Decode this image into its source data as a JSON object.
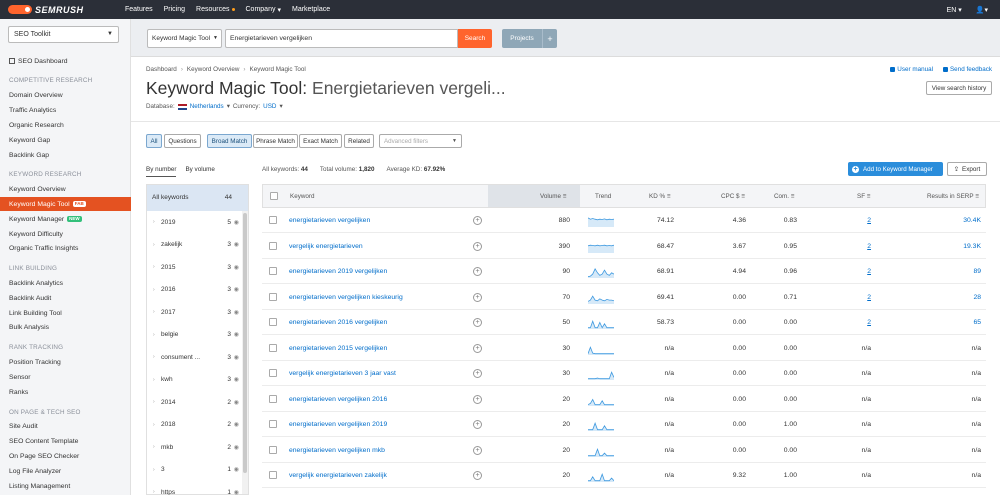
{
  "topbar": {
    "brand": "SEMRUSH",
    "nav": [
      "Features",
      "Pricing",
      "Resources",
      "Company",
      "Marketplace"
    ],
    "lang": "EN",
    "colors": {
      "bg": "#2b2f38",
      "accent": "#ff642d"
    }
  },
  "sidebar": {
    "toolkit": "SEO Toolkit",
    "dashboard": "SEO Dashboard",
    "sections": {
      "competitive": "COMPETITIVE RESEARCH",
      "keyword": "KEYWORD RESEARCH",
      "link": "LINK BUILDING",
      "rank": "RANK TRACKING",
      "onpage": "ON PAGE & TECH SEO"
    },
    "items": {
      "domain_overview": "Domain Overview",
      "traffic_analytics": "Traffic Analytics",
      "organic_research": "Organic Research",
      "keyword_gap": "Keyword Gap",
      "backlink_gap": "Backlink Gap",
      "keyword_overview": "Keyword Overview",
      "keyword_magic": "Keyword Magic Tool",
      "keyword_manager": "Keyword Manager",
      "keyword_difficulty": "Keyword Difficulty",
      "organic_insights": "Organic Traffic Insights",
      "backlink_analytics": "Backlink Analytics",
      "backlink_audit": "Backlink Audit",
      "link_building_tool": "Link Building Tool",
      "bulk_analysis": "Bulk Analysis",
      "position_tracking": "Position Tracking",
      "sensor": "Sensor",
      "ranks": "Ranks",
      "site_audit": "Site Audit",
      "seo_content_template": "SEO Content Template",
      "on_page_checker": "On Page SEO Checker",
      "log_file_analyzer": "Log File Analyzer",
      "listing_management": "Listing Management"
    },
    "badge_magic": "FAB",
    "badge_manager": "NEW"
  },
  "search": {
    "database": "Keyword Magic Tool",
    "query": "Energietarieven vergelijken",
    "button": "Search",
    "projects": "Projects",
    "projects_plus": "+"
  },
  "header": {
    "breadcrumb": [
      "Dashboard",
      "Keyword Overview",
      "Keyword Magic Tool"
    ],
    "title_prefix": "Keyword Magic Tool:",
    "title_keyword": "Energietarieven vergeli...",
    "database_label": "Database:",
    "database_value": "Netherlands",
    "currency_label": "Currency:",
    "currency_value": "USD",
    "user_manual": "User manual",
    "send_feedback": "Send feedback",
    "view_history": "View search history"
  },
  "filters": {
    "all": "All",
    "questions": "Questions",
    "broad": "Broad Match",
    "phrase": "Phrase Match",
    "exact": "Exact Match",
    "related": "Related",
    "advanced_placeholder": "Advanced filters"
  },
  "groups": {
    "tab_number": "By number",
    "tab_volume": "By volume",
    "all_label": "All keywords",
    "all_count": "44",
    "rows": [
      {
        "name": "2019",
        "count": "5"
      },
      {
        "name": "zakelijk",
        "count": "3"
      },
      {
        "name": "2015",
        "count": "3"
      },
      {
        "name": "2016",
        "count": "3"
      },
      {
        "name": "2017",
        "count": "3"
      },
      {
        "name": "belgie",
        "count": "3"
      },
      {
        "name": "consument ...",
        "count": "3"
      },
      {
        "name": "kwh",
        "count": "3"
      },
      {
        "name": "2014",
        "count": "2"
      },
      {
        "name": "2018",
        "count": "2"
      },
      {
        "name": "mkb",
        "count": "2"
      },
      {
        "name": "3",
        "count": "1"
      },
      {
        "name": "https",
        "count": "1"
      }
    ]
  },
  "stats": {
    "all_label": "All keywords:",
    "all_value": "44",
    "volume_label": "Total volume:",
    "volume_value": "1,820",
    "kd_label": "Average KD:",
    "kd_value": "67.92%",
    "add_button": "Add to Keyword Manager",
    "export_button": "Export"
  },
  "table": {
    "headers": {
      "keyword": "Keyword",
      "volume": "Volume",
      "trend": "Trend",
      "kd": "KD %",
      "cpc": "CPC $",
      "com": "Com.",
      "sf": "SF",
      "results": "Results in SERP"
    },
    "rows": [
      {
        "keyword": "energietarieven vergelijken",
        "volume": "880",
        "kd": "74.12",
        "cpc": "4.36",
        "com": "0.83",
        "sf": "2",
        "results": "30.4K",
        "trend": [
          0.7,
          0.6,
          0.65,
          0.6,
          0.55,
          0.6,
          0.58,
          0.62,
          0.55,
          0.6,
          0.58,
          0.6
        ]
      },
      {
        "keyword": "vergelijk energietarieven",
        "volume": "390",
        "kd": "68.47",
        "cpc": "3.67",
        "com": "0.95",
        "sf": "2",
        "results": "19.3K",
        "trend": [
          0.55,
          0.6,
          0.58,
          0.55,
          0.6,
          0.55,
          0.58,
          0.6,
          0.55,
          0.58,
          0.55,
          0.6
        ]
      },
      {
        "keyword": "energietarieven 2019 vergelijken",
        "volume": "90",
        "kd": "68.91",
        "cpc": "4.94",
        "com": "0.96",
        "sf": "2",
        "results": "89",
        "trend": [
          0.1,
          0.15,
          0.3,
          0.7,
          0.4,
          0.2,
          0.3,
          0.6,
          0.3,
          0.2,
          0.4,
          0.3
        ]
      },
      {
        "keyword": "energietarieven vergelijken kieskeurig",
        "volume": "70",
        "kd": "69.41",
        "cpc": "0.00",
        "com": "0.71",
        "sf": "2",
        "results": "28",
        "trend": [
          0.2,
          0.3,
          0.6,
          0.3,
          0.25,
          0.4,
          0.3,
          0.25,
          0.35,
          0.3,
          0.3,
          0.25
        ]
      },
      {
        "keyword": "energietarieven 2016 vergelijken",
        "volume": "50",
        "kd": "58.73",
        "cpc": "0.00",
        "com": "0.00",
        "sf": "2",
        "results": "65",
        "trend": [
          0.1,
          0.1,
          0.6,
          0.1,
          0.1,
          0.5,
          0.1,
          0.4,
          0.1,
          0.1,
          0.1,
          0.1
        ]
      },
      {
        "keyword": "energietarieven 2015 vergelijken",
        "volume": "30",
        "kd": "n/a",
        "cpc": "0.00",
        "com": "0.00",
        "sf": "n/a",
        "results": "n/a",
        "trend": [
          0.1,
          0.6,
          0.15,
          0.1,
          0.1,
          0.1,
          0.1,
          0.1,
          0.1,
          0.1,
          0.1,
          0.1
        ]
      },
      {
        "keyword": "vergelijk energietarieven 3 jaar vast",
        "volume": "30",
        "kd": "n/a",
        "cpc": "0.00",
        "com": "0.00",
        "sf": "n/a",
        "results": "n/a",
        "trend": [
          0.1,
          0.1,
          0.1,
          0.1,
          0.15,
          0.1,
          0.1,
          0.1,
          0.1,
          0.1,
          0.6,
          0.2
        ]
      },
      {
        "keyword": "energietarieven vergelijken 2016",
        "volume": "20",
        "kd": "n/a",
        "cpc": "0.00",
        "com": "0.00",
        "sf": "n/a",
        "results": "n/a",
        "trend": [
          0.1,
          0.2,
          0.5,
          0.1,
          0.1,
          0.1,
          0.4,
          0.1,
          0.1,
          0.1,
          0.1,
          0.1
        ]
      },
      {
        "keyword": "energietarieven vergelijken 2019",
        "volume": "20",
        "kd": "n/a",
        "cpc": "0.00",
        "com": "1.00",
        "sf": "n/a",
        "results": "n/a",
        "trend": [
          0.1,
          0.1,
          0.1,
          0.6,
          0.1,
          0.1,
          0.1,
          0.4,
          0.1,
          0.1,
          0.1,
          0.1
        ]
      },
      {
        "keyword": "energietarieven vergelijken mkb",
        "volume": "20",
        "kd": "n/a",
        "cpc": "0.00",
        "com": "0.00",
        "sf": "n/a",
        "results": "n/a",
        "trend": [
          0.1,
          0.1,
          0.1,
          0.1,
          0.6,
          0.1,
          0.1,
          0.3,
          0.1,
          0.1,
          0.1,
          0.1
        ]
      },
      {
        "keyword": "vergelijk energietarieven zakelijk",
        "volume": "20",
        "kd": "n/a",
        "cpc": "9.32",
        "com": "1.00",
        "sf": "n/a",
        "results": "n/a",
        "trend": [
          0.1,
          0.1,
          0.4,
          0.1,
          0.1,
          0.1,
          0.6,
          0.1,
          0.1,
          0.1,
          0.3,
          0.1
        ]
      }
    ]
  }
}
